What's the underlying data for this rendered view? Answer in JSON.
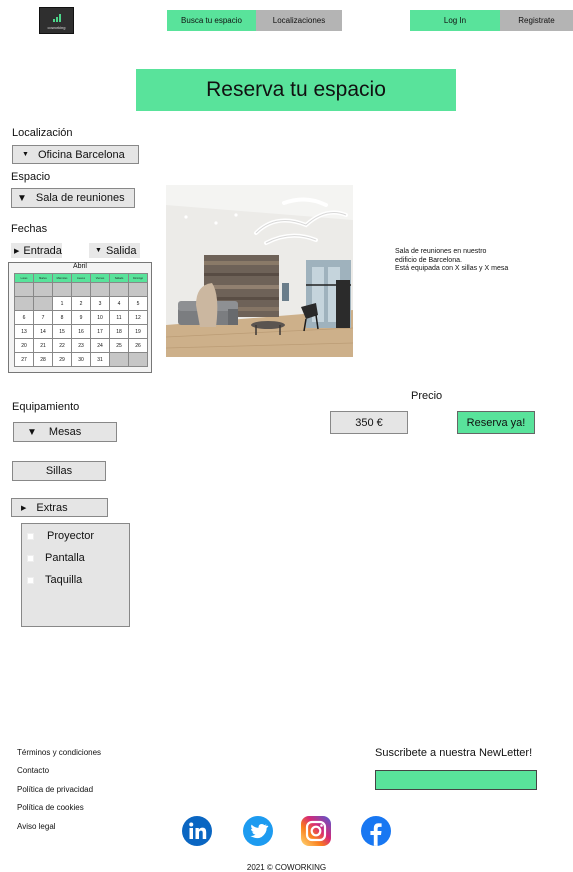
{
  "header": {
    "logo_text": "coworking",
    "nav": {
      "search": "Busca tu espacio",
      "locations": "Localizaciones"
    },
    "auth": {
      "login": "Log In",
      "register": "Registrate"
    }
  },
  "hero": {
    "title": "Reserva tu espacio"
  },
  "form": {
    "location": {
      "label": "Localización",
      "value": "Oficina Barcelona"
    },
    "space": {
      "label": "Espacio",
      "value": "Sala de reuniones"
    },
    "dates": {
      "label": "Fechas",
      "start": "Entrada",
      "end": "Salida"
    },
    "calendar": {
      "month": "Abril",
      "weekdays": [
        "Lunes",
        "Martes",
        "Miércoles",
        "Jueves",
        "Viernes",
        "Sábado",
        "Domingo"
      ],
      "weeks": [
        [
          "",
          "",
          "",
          "",
          "",
          "",
          ""
        ],
        [
          "",
          "",
          "1",
          "2",
          "3",
          "4",
          "5"
        ],
        [
          "6",
          "7",
          "8",
          "9",
          "10",
          "11",
          "12"
        ],
        [
          "13",
          "14",
          "15",
          "16",
          "17",
          "18",
          "19"
        ],
        [
          "20",
          "21",
          "22",
          "23",
          "24",
          "25",
          "26"
        ],
        [
          "27",
          "28",
          "29",
          "30",
          "31",
          "",
          ""
        ]
      ]
    },
    "equipment": {
      "label": "Equipamiento",
      "tables": "Mesas",
      "chairs": "Sillas",
      "extras": "Extras",
      "extras_options": [
        "Proyector",
        "Pantalla",
        "Taquilla"
      ]
    }
  },
  "space_info": {
    "description_lines": [
      "Sala de reuniones en nuestro",
      "edificio de Barcelona.",
      "Está equipada con X sillas y X mesa"
    ]
  },
  "pricing": {
    "label": "Precio",
    "value": "350 €",
    "cta": "Reserva ya!"
  },
  "footer": {
    "links": [
      "Términos y condiciones",
      "Contacto",
      "Política de privacidad",
      "Política de cookies",
      "Aviso legal"
    ],
    "newsletter_label": "Suscribete a nuestra NewLetter!",
    "social": [
      "linkedin-icon",
      "twitter-icon",
      "instagram-icon",
      "facebook-icon"
    ],
    "copyright": "2021 © COWORKING"
  },
  "colors": {
    "accent": "#59e39b",
    "neutral": "#b4b4b4",
    "linkedin": "#0a66c2",
    "twitter": "#1d9bf0",
    "facebook": "#1877f2"
  }
}
